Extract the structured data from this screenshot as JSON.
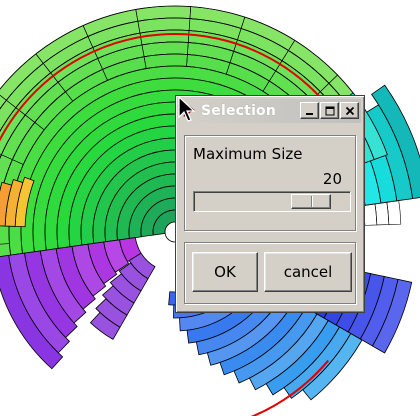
{
  "dialog": {
    "title": "Selection",
    "label": "Maximum Size",
    "value": "20",
    "slider_fraction": 0.83,
    "ok_label": "OK",
    "cancel_label": "cancel"
  },
  "icons": {
    "title_icon": "tk-feather-icon",
    "minimize": "minimize-icon",
    "maximize": "maximize-icon",
    "close": "close-icon",
    "cursor": "arrow-cursor-icon"
  },
  "colors": {
    "dialog_face": "#d4d0c8",
    "ring_outline": "#000000",
    "highlight_ring": "#e00000"
  }
}
